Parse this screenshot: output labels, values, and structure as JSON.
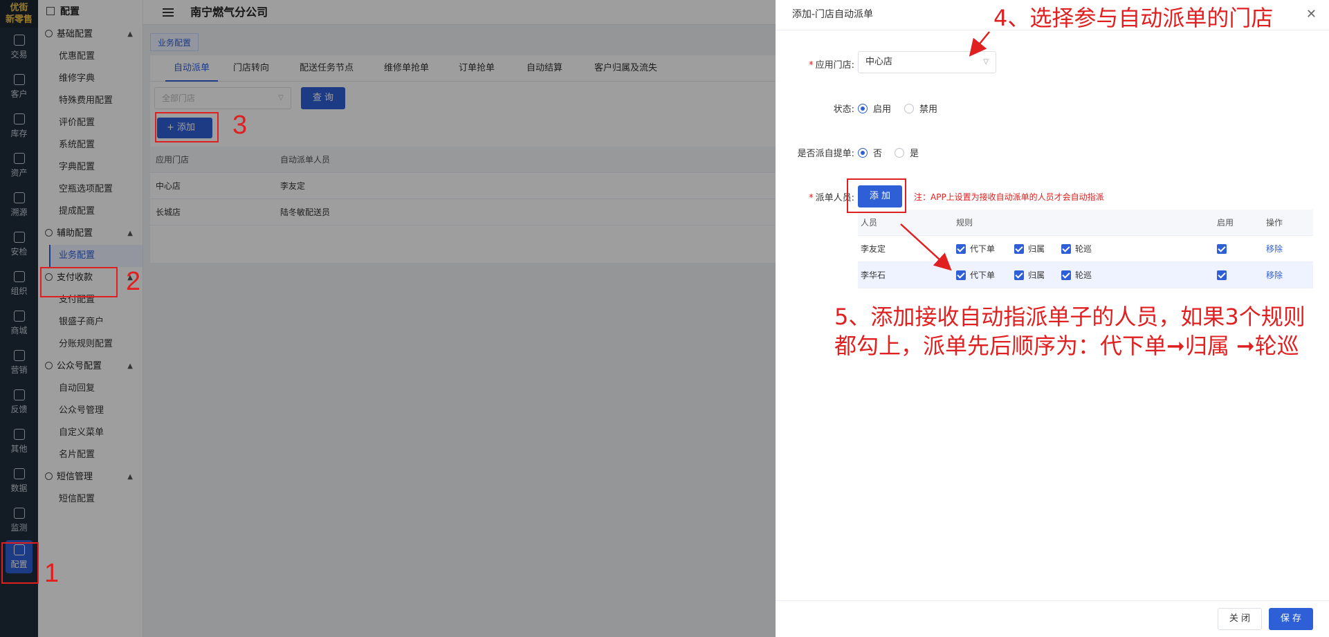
{
  "nav": {
    "logo_top": "优街",
    "logo_bottom": "新零售",
    "items": [
      "交易",
      "客户",
      "库存",
      "资产",
      "溯源",
      "安检",
      "组织",
      "商城",
      "营销",
      "反馈",
      "其他",
      "数据",
      "监测",
      "配置"
    ]
  },
  "menu": {
    "title": "配置",
    "groups": [
      {
        "label": "基础配置",
        "items": [
          "优惠配置",
          "维修字典",
          "特殊费用配置",
          "评价配置",
          "系统配置",
          "字典配置",
          "空瓶选项配置",
          "提成配置"
        ]
      },
      {
        "label": "辅助配置",
        "items": [
          "业务配置"
        ]
      },
      {
        "label": "支付收款",
        "items": [
          "支付配置",
          "银盛子商户",
          "分账规则配置"
        ]
      },
      {
        "label": "公众号配置",
        "items": [
          "自动回复",
          "公众号管理",
          "自定义菜单",
          "名片配置"
        ]
      },
      {
        "label": "短信管理",
        "items": [
          "短信配置"
        ]
      }
    ]
  },
  "topbar": {
    "company": "南宁燃气分公司"
  },
  "page_tab": "业务配置",
  "tabs": [
    "自动派单",
    "门店转向",
    "配送任务节点",
    "维修单抢单",
    "订单抢单",
    "自动结算",
    "客户归属及流失"
  ],
  "filter": {
    "store_placeholder": "全部门店",
    "query_label": "查 询",
    "add_label": "添加"
  },
  "table1": {
    "headers": [
      "应用门店",
      "自动派单人员"
    ],
    "rows": [
      [
        "中心店",
        "李友定"
      ],
      [
        "长城店",
        "陆冬敏配送员"
      ]
    ]
  },
  "drawer": {
    "title": "添加-门店自动派单",
    "store_label": "应用门店:",
    "store_value": "中心店",
    "status_label": "状态:",
    "status_on": "启用",
    "status_off": "禁用",
    "self_pick_label": "是否派自提单:",
    "self_pick_no": "否",
    "self_pick_yes": "是",
    "dispatcher_label": "派单人员:",
    "add_label": "添 加",
    "note": "注：APP上设置为接收自动派单的人员才会自动指派",
    "table": {
      "headers": [
        "人员",
        "规则",
        "启用",
        "操作"
      ],
      "rules": [
        "代下单",
        "归属",
        "轮巡"
      ],
      "rows": [
        {
          "name": "李友定",
          "action": "移除"
        },
        {
          "name": "李华石",
          "action": "移除"
        }
      ]
    },
    "close_label": "关 闭",
    "save_label": "保 存"
  },
  "annotations": {
    "n1": "1",
    "n2": "2",
    "n3": "3",
    "step4": "4、选择参与自动派单的门店",
    "step5_line1": "5、添加接收自动指派单子的人员，如果3个规则",
    "step5_line2": "都勾上，派单先后顺序为：代下单➞归属 ➞轮巡"
  },
  "colors": {
    "primary": "#2f5fd6",
    "annotation": "#e02020",
    "nav_bg": "#1f2d3d"
  }
}
